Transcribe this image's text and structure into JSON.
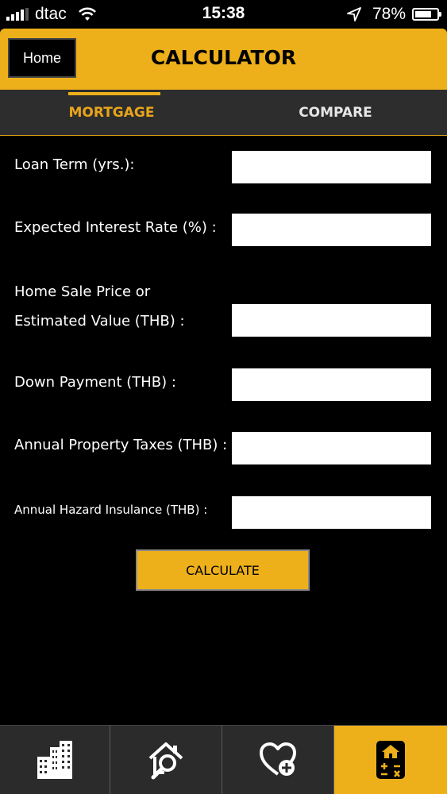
{
  "status_bar": {
    "carrier": "dtac",
    "time": "15:38",
    "battery": "78%",
    "battery_level": 0.78,
    "signal_bars": 4,
    "signal_bars_total": 5
  },
  "header": {
    "home_label": "Home",
    "title": "CALCULATOR"
  },
  "tabs": [
    {
      "label": "MORTGAGE",
      "active": true
    },
    {
      "label": "COMPARE",
      "active": false
    }
  ],
  "form": {
    "loan_term": {
      "label": "Loan Term (yrs.):",
      "value": ""
    },
    "interest_rate": {
      "label": "Expected Interest Rate (%) :",
      "value": ""
    },
    "home_price": {
      "label_line1": "Home Sale Price or",
      "label_line2": "Estimated Value (THB) :",
      "value": ""
    },
    "down_payment": {
      "label": "Down Payment (THB) :",
      "value": ""
    },
    "property_taxes": {
      "label": "Annual Property Taxes (THB) :",
      "value": ""
    },
    "hazard_insurance": {
      "label": "Annual Hazard Insulance (THB) :",
      "value": ""
    }
  },
  "calculate_label": "CALCULATE",
  "tabbar": [
    {
      "icon": "buildings-icon",
      "active": false
    },
    {
      "icon": "home-search-icon",
      "active": false
    },
    {
      "icon": "heart-add-icon",
      "active": false
    },
    {
      "icon": "calculator-icon",
      "active": true
    }
  ],
  "colors": {
    "accent": "#edb01a",
    "background": "#000000",
    "tab_bar_bg": "#2d2d2d"
  }
}
